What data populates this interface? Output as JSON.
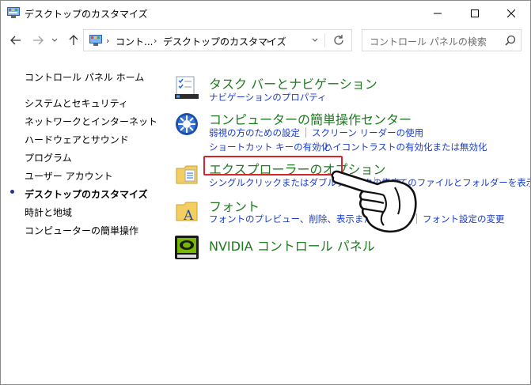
{
  "window": {
    "title": "デスクトップのカスタマイズ"
  },
  "address": {
    "crumbs": [
      "コント...",
      "デスクトップのカスタマイズ"
    ],
    "separator": "›"
  },
  "search": {
    "placeholder": "コントロール パネルの検索"
  },
  "sidebar": {
    "home": "コントロール パネル ホーム",
    "items": [
      {
        "label": "システムとセキュリティ"
      },
      {
        "label": "ネットワークとインターネット"
      },
      {
        "label": "ハードウェアとサウンド"
      },
      {
        "label": "プログラム"
      },
      {
        "label": "ユーザー アカウント"
      },
      {
        "label": "デスクトップのカスタマイズ",
        "current": true
      },
      {
        "label": "時計と地域"
      },
      {
        "label": "コンピューターの簡単操作"
      }
    ]
  },
  "categories": [
    {
      "icon": "taskbar-icon",
      "title": "タスク バーとナビゲーション",
      "links": [
        "ナビゲーションのプロパティ"
      ]
    },
    {
      "icon": "ease-of-access-icon",
      "title": "コンピューターの簡単操作センター",
      "links": [
        "弱視の方のための設定",
        "スクリーン リーダーの使用",
        "ショートカット キーの有効化",
        "ハイコントラストの有効化または無効化"
      ]
    },
    {
      "icon": "folder-options-icon",
      "title": "エクスプローラーのオプション",
      "links": [
        "シングルクリックまたはダブルクリックの指定",
        "すべてのファイルとフォルダーを表示"
      ]
    },
    {
      "icon": "fonts-icon",
      "title": "フォント",
      "links": [
        "フォントのプレビュー、削除、表示または非表示",
        "フォント設定の変更"
      ]
    },
    {
      "icon": "nvidia-icon",
      "title": "NVIDIA コントロール パネル",
      "links": []
    }
  ],
  "colors": {
    "category_title": "#1e7a1e",
    "link": "#1a3cc8",
    "highlight": "#d9232a"
  }
}
